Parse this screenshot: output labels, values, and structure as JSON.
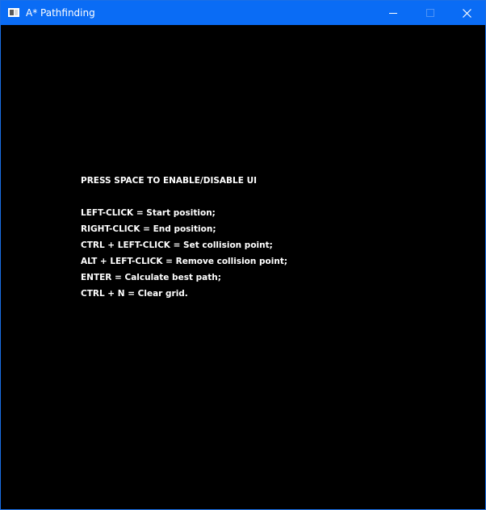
{
  "window": {
    "title": "A* Pathfinding",
    "icons": {
      "app": "window-app-icon",
      "minimize": "minimize-icon",
      "maximize": "maximize-icon",
      "close": "close-icon"
    }
  },
  "ui": {
    "toggle_hint": "PRESS SPACE TO ENABLE/DISABLE UI",
    "instructions": [
      "LEFT-CLICK = Start position;",
      "RIGHT-CLICK = End position;",
      "CTRL + LEFT-CLICK = Set collision point;",
      "ALT + LEFT-CLICK = Remove collision point;",
      "ENTER = Calculate best path;",
      "CTRL + N = Clear grid."
    ]
  },
  "colors": {
    "titlebar": "#0a6cf5",
    "window_border": "#1a6fe6",
    "background": "#000000",
    "text": "#ffffff"
  }
}
